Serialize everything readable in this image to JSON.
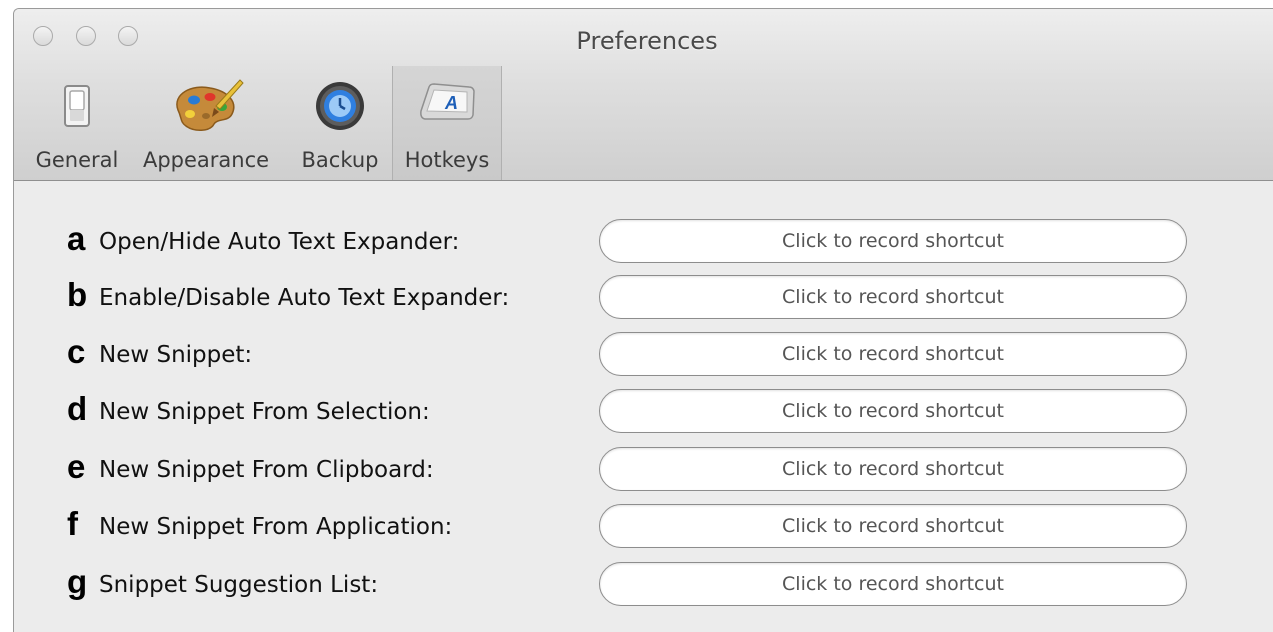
{
  "window": {
    "title": "Preferences"
  },
  "toolbar": {
    "items": [
      {
        "label": "General",
        "icon": "switch-icon"
      },
      {
        "label": "Appearance",
        "icon": "palette-icon"
      },
      {
        "label": "Backup",
        "icon": "time-machine-icon"
      },
      {
        "label": "Hotkeys",
        "icon": "keyboard-key-icon",
        "selected": true
      }
    ]
  },
  "hotkeys": {
    "rows": [
      {
        "letter": "a",
        "label": "Open/Hide Auto Text Expander:",
        "shortcut": "Click to record shortcut"
      },
      {
        "letter": "b",
        "label": "Enable/Disable Auto Text Expander:",
        "shortcut": "Click to record shortcut"
      },
      {
        "letter": "c",
        "label": "New Snippet:",
        "shortcut": "Click to record shortcut"
      },
      {
        "letter": "d",
        "label": "New Snippet From Selection:",
        "shortcut": "Click to record shortcut"
      },
      {
        "letter": "e",
        "label": "New Snippet From Clipboard:",
        "shortcut": "Click to record shortcut"
      },
      {
        "letter": "f",
        "label": "New Snippet From Application:",
        "shortcut": "Click to record shortcut"
      },
      {
        "letter": "g",
        "label": "Snippet Suggestion List:",
        "shortcut": "Click to record shortcut"
      }
    ]
  }
}
